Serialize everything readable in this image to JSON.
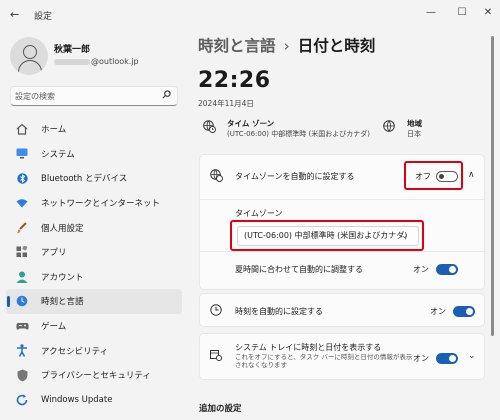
{
  "window": {
    "back_icon": "←",
    "title": "設定",
    "minimize": "—",
    "maximize": "☐",
    "close": "✕"
  },
  "profile": {
    "name": "秋葉一郎",
    "email_suffix": "@outlook.jp"
  },
  "search": {
    "placeholder": "設定の検索",
    "icon": "search-icon"
  },
  "sidebar": {
    "items": [
      {
        "label": "ホーム",
        "icon": "home-icon",
        "selected": false
      },
      {
        "label": "システム",
        "icon": "monitor-icon",
        "selected": false
      },
      {
        "label": "Bluetooth とデバイス",
        "icon": "bluetooth-icon",
        "selected": false
      },
      {
        "label": "ネットワークとインターネット",
        "icon": "wifi-icon",
        "selected": false
      },
      {
        "label": "個人用設定",
        "icon": "brush-icon",
        "selected": false
      },
      {
        "label": "アプリ",
        "icon": "apps-icon",
        "selected": false
      },
      {
        "label": "アカウント",
        "icon": "account-icon",
        "selected": false
      },
      {
        "label": "時刻と言語",
        "icon": "clock-globe-icon",
        "selected": true
      },
      {
        "label": "ゲーム",
        "icon": "gamepad-icon",
        "selected": false
      },
      {
        "label": "アクセシビリティ",
        "icon": "accessibility-icon",
        "selected": false
      },
      {
        "label": "プライバシーとセキュリティ",
        "icon": "shield-icon",
        "selected": false
      },
      {
        "label": "Windows Update",
        "icon": "update-icon",
        "selected": false
      }
    ]
  },
  "header": {
    "parent": "時刻と言語",
    "separator": "›",
    "current": "日付と時刻"
  },
  "clock": {
    "time": "22:26",
    "date": "2024年11月4日"
  },
  "info": {
    "timezone_title": "タイム ゾーン",
    "timezone_value": "(UTC-06:00) 中部標準時 (米国およびカナダ)",
    "region_title": "地域",
    "region_value": "日本"
  },
  "auto_timezone": {
    "label": "タイムゾーンを自動的に設定する",
    "state_label": "オフ",
    "on": false,
    "chevron": "∧"
  },
  "timezone_section": {
    "label": "タイムゾーン",
    "selected": "(UTC-06:00) 中部標準時 (米国およびカナダ)",
    "chevron": "⌄"
  },
  "dst": {
    "label": "夏時間に合わせて自動的に調整する",
    "state_label": "オン",
    "on": true
  },
  "auto_time": {
    "label": "時刻を自動的に設定する",
    "state_label": "オン",
    "on": true
  },
  "tray": {
    "label": "システム トレイに時刻と日付を表示する",
    "sublabel_line1": "これをオフにすると、タスク バーに時刻と日付の情報が表示",
    "sublabel_line2": "されなくなります",
    "state_label": "オン",
    "on": true,
    "chevron": "⌄"
  },
  "additional": {
    "title": "追加の設定"
  },
  "colors": {
    "accent": "#1a5fb4",
    "highlight": "#e10012",
    "background": "#f3f3f3"
  }
}
